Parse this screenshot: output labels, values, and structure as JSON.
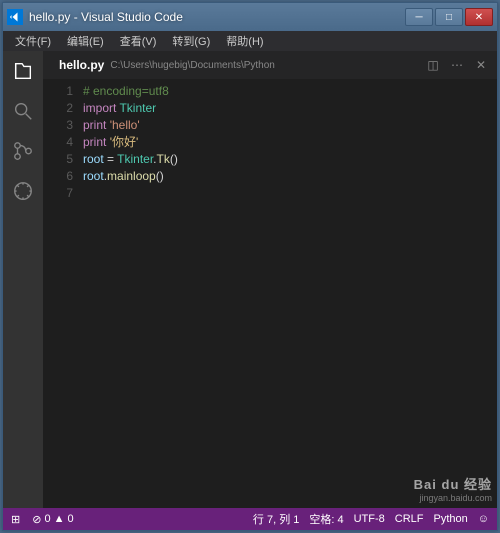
{
  "window": {
    "title": "hello.py - Visual Studio Code"
  },
  "menubar": {
    "file": "文件(F)",
    "edit": "编辑(E)",
    "view": "查看(V)",
    "goto": "转到(G)",
    "help": "帮助(H)"
  },
  "tab": {
    "name": "hello.py",
    "path": "C:\\Users\\hugebig\\Documents\\Python"
  },
  "code": {
    "lines": [
      "1",
      "2",
      "3",
      "4",
      "5",
      "6",
      "7"
    ],
    "l1_comment": "# encoding=utf8",
    "l2_kw": "import ",
    "l2_mod": "Tkinter",
    "l3_kw": "print ",
    "l3_str": "'hello'",
    "l4_kw": "print ",
    "l4_str": "'你好'",
    "l5_var": "root",
    "l5_eq": " = ",
    "l5_cls": "Tkinter",
    "l5_dot": ".",
    "l5_fn": "Tk",
    "l5_paren": "()",
    "l6_var": "root",
    "l6_dot": ".",
    "l6_fn": "mainloop",
    "l6_paren": "()"
  },
  "status": {
    "errors": "0",
    "warnings": "0",
    "cursor": "行 7, 列 1",
    "spaces": "空格: 4",
    "encoding": "UTF-8",
    "eol": "CRLF",
    "lang": "Python",
    "feedback": "☺"
  },
  "watermark": {
    "main": "Bai du 经验",
    "sub": "jingyan.baidu.com"
  }
}
